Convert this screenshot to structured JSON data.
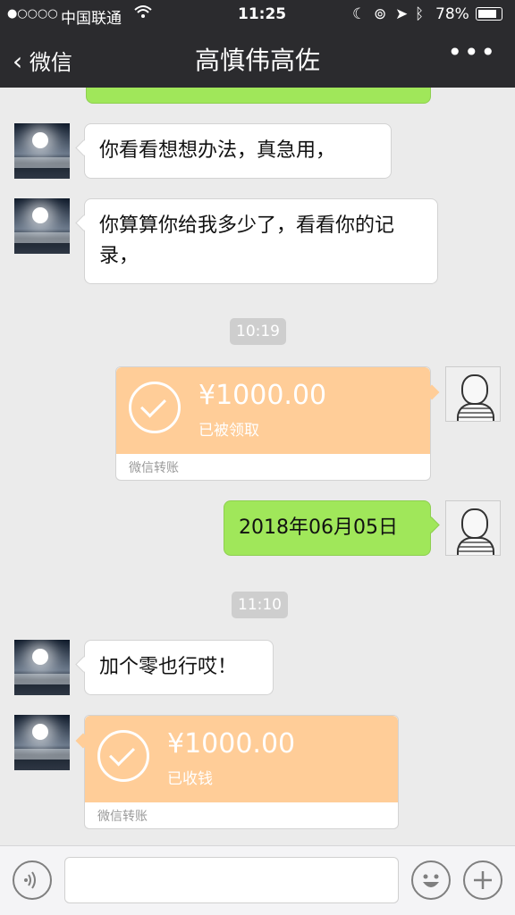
{
  "status_bar": {
    "signal": "●○○○○",
    "carrier": "中国联通",
    "wifi": "wifi-icon",
    "time": "11:25",
    "battery": "78%"
  },
  "nav": {
    "back_label": "微信",
    "title": "高慎伟高佐",
    "more_label": "•••"
  },
  "messages": {
    "m1": "你看看想想办法，真急用，",
    "m2": "你算算你给我多少了，看看你的记录，",
    "time1": "10:19",
    "transfer1": {
      "amount": "¥1000.00",
      "status": "已被领取",
      "label": "微信转账"
    },
    "m3": "2018年06月05日",
    "time2": "11:10",
    "m4": "加个零也行哎！",
    "transfer2": {
      "amount": "¥1000.00",
      "status": "已收钱",
      "label": "微信转账"
    }
  },
  "input_bar": {
    "voice_icon": "voice-icon",
    "emoji_icon": "emoji-icon",
    "plus_icon": "plus-icon"
  },
  "colors": {
    "nav_bg": "#2b2b2e",
    "chat_bg": "#ebebeb",
    "sent_bubble": "#a0e75a",
    "transfer_orange": "#ffcd98"
  }
}
